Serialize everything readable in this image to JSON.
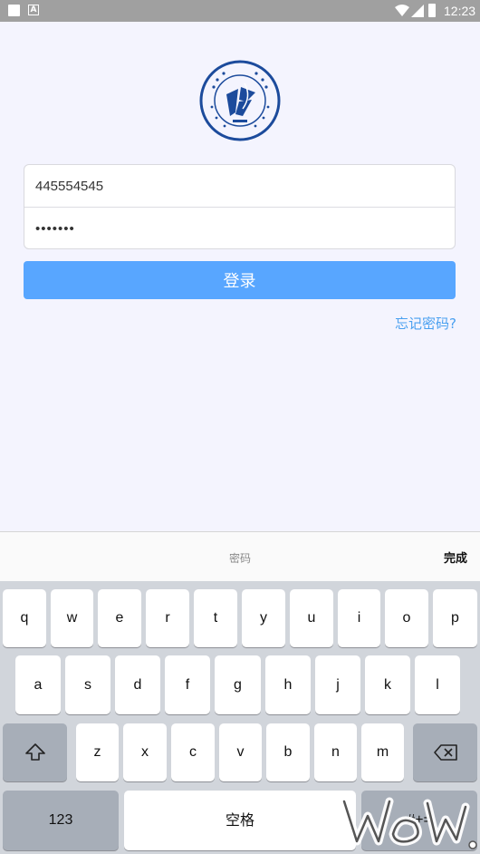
{
  "status_bar": {
    "time": "12:23"
  },
  "form": {
    "username_value": "445554545",
    "password_value": "•••••••",
    "login_label": "登录",
    "forgot_label": "忘记密码?"
  },
  "keyboard": {
    "hint": "密码",
    "done_label": "完成",
    "row1": [
      "q",
      "w",
      "e",
      "r",
      "t",
      "y",
      "u",
      "i",
      "o",
      "p"
    ],
    "row2": [
      "a",
      "s",
      "d",
      "f",
      "g",
      "h",
      "j",
      "k",
      "l"
    ],
    "row3": [
      "z",
      "x",
      "c",
      "v",
      "b",
      "n",
      "m"
    ],
    "numbers_label": "123",
    "space_label": "空格",
    "symbols_label": "#+="
  },
  "colors": {
    "accent": "#58a6ff",
    "link": "#4aa0f0",
    "logo": "#1c4b9c"
  }
}
